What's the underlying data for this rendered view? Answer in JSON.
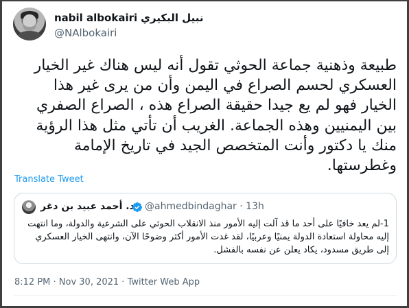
{
  "author": {
    "name": "nabil albokairi",
    "name_arabic": "نبيل البكيري",
    "handle": "@NAlbokairi"
  },
  "tweet": {
    "text": "طبيعة وذهنية جماعة الحوثي تقول أنه ليس هناك غير الخيار العسكري لحسم الصراع في اليمن وأن من يرى غير هذا الخيار فهو لم يع جيدا حقيقة الصراع هذه ، الصراع الصفري بين اليمنيين وهذه الجماعة. الغريب أن تأتي مثل هذا الرؤية منك يا دكتور وأنت المتخصص الجيد في تاريخ الإمامة وغطرستها.",
    "translate_label": "Translate Tweet",
    "timestamp": "8:12 PM · Nov 30, 2021 · Twitter Web App"
  },
  "quoted_tweet": {
    "name": "د. أحمد عبيد بن دغر",
    "handle": "@ahmedbindaghar",
    "separator": "·",
    "time": "13h",
    "text": "1-لم يعد خافيًا على أحد ما قد آلت إليه الأمور منذ الانقلاب الحوثي على الشرعية والدولة، وما انتهت إليه محاولة استعادة الدولة يمنيًا وعربيًا، لقد غدت الأمور أكثر وضوحًا الآن، وانتهى الخيار العسكري إلى طريق مسدود، يكاد يعلن عن نفسه بالفشل."
  },
  "colors": {
    "text": "#0f1419",
    "secondary": "#536471",
    "link": "#1d9bf0",
    "border": "#cfd9de",
    "verified": "#1d9bf0"
  }
}
